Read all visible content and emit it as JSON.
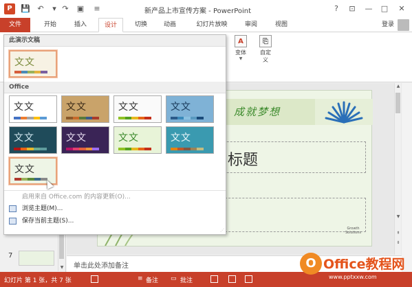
{
  "window": {
    "title": "新产品上市宣传方案 - PowerPoint",
    "app_logo": "P",
    "controls": [
      "?",
      "⊡",
      "—",
      "□",
      "✕"
    ]
  },
  "qat": {
    "icons": [
      "save-icon",
      "undo-icon",
      "redo-icon",
      "start-from-beginning-icon",
      "customize-qat-icon"
    ]
  },
  "tabs": [
    {
      "label": "文件"
    },
    {
      "label": "开始"
    },
    {
      "label": "插入"
    },
    {
      "label": "设计"
    },
    {
      "label": "切换"
    },
    {
      "label": "动画"
    },
    {
      "label": "幻灯片放映"
    },
    {
      "label": "审阅"
    },
    {
      "label": "视图"
    }
  ],
  "account": {
    "login": "登录"
  },
  "ribbon": {
    "variants_label": "变体",
    "customize_label": "自定义",
    "customize_line1": "自定",
    "customize_line2": "义"
  },
  "gallery": {
    "section_this": "此演示文稿",
    "section_office": "Office",
    "theme_glyph": "文文",
    "menu": [
      {
        "label": "启用来自 Office.com 的内容更新(O)...",
        "disabled": true
      },
      {
        "label": "浏览主题(M)...",
        "disabled": false
      },
      {
        "label": "保存当前主题(S)...",
        "disabled": false
      }
    ]
  },
  "slide": {
    "header_text": "成就梦想",
    "title_placeholder": "标题",
    "stamp_line1": "Growth",
    "stamp_line2": "Solutions"
  },
  "thumbnails": {
    "visible_number": "7"
  },
  "notes": {
    "placeholder": "单击此处添加备注"
  },
  "status": {
    "slide_info": "幻灯片 第 1 张，共 7 张",
    "notes": "备注",
    "comments": "批注"
  },
  "watermark": {
    "brand": "Office教程网",
    "logo": "O",
    "url": "www.pptxxw.com"
  },
  "colors": {
    "accent": "#c8402a",
    "selected_theme_border": "#e8a27a"
  }
}
